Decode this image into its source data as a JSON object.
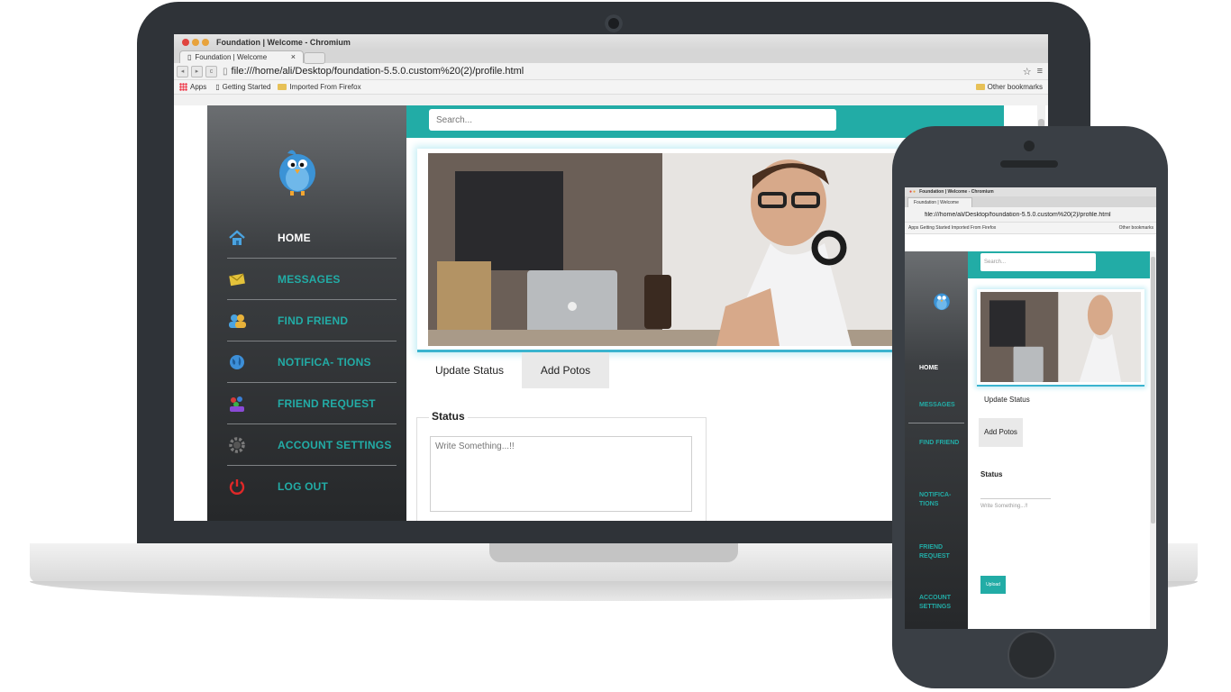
{
  "browser": {
    "window_title": "Foundation | Welcome - Chromium",
    "tab_title": "Foundation | Welcome",
    "tab_close": "×",
    "url": "file:///home/ali/Desktop/foundation-5.5.0.custom%20(2)/profile.html",
    "bookmarks": [
      "Apps",
      "Getting Started",
      "Imported From Firefox"
    ],
    "other_bookmarks": "Other bookmarks"
  },
  "sidebar": {
    "items": [
      {
        "label": "HOME",
        "icon": "home-icon",
        "color": "#ffffff"
      },
      {
        "label": "MESSAGES",
        "icon": "messages-icon",
        "color": "#22aca6"
      },
      {
        "label": "FIND FRIEND",
        "icon": "find-friend-icon",
        "color": "#22aca6"
      },
      {
        "label": "NOTIFICA- TIONS",
        "icon": "globe-icon",
        "color": "#22aca6"
      },
      {
        "label": "FRIEND REQUEST",
        "icon": "friend-request-icon",
        "color": "#22aca6"
      },
      {
        "label": "ACCOUNT SETTINGS",
        "icon": "gear-icon",
        "color": "#22aca6"
      },
      {
        "label": "LOG OUT",
        "icon": "power-icon",
        "color": "#22aca6"
      }
    ]
  },
  "search": {
    "placeholder": "Search..."
  },
  "tabs": {
    "update_status": "Update Status",
    "add_photos": "Add Potos"
  },
  "status": {
    "legend": "Status",
    "placeholder": "Write Something...!!"
  },
  "phone": {
    "window_title": "Foundation | Welcome - Chromium",
    "tab_title": "Foundation | Welcome",
    "url": "file:///home/ali/Desktop/foundation-5.5.0.custom%20(2)/profile.html",
    "bookmarks": "Apps  Getting Started  Imported From Firefox",
    "other_bookmarks": "Other bookmarks",
    "search_placeholder": "Search...",
    "nav": [
      "HOME",
      "MESSAGES",
      "FIND FRIEND",
      "NOTIFICA- TIONS",
      "FRIEND REQUEST",
      "ACCOUNT SETTINGS"
    ],
    "update_status": "Update Status",
    "add_photos": "Add Potos",
    "status_legend": "Status",
    "status_placeholder": "Write Something...!!",
    "button": "Upload"
  },
  "colors": {
    "accent": "#22aca6",
    "frame": "#2f3338",
    "cover_border": "#3bb4cf"
  }
}
